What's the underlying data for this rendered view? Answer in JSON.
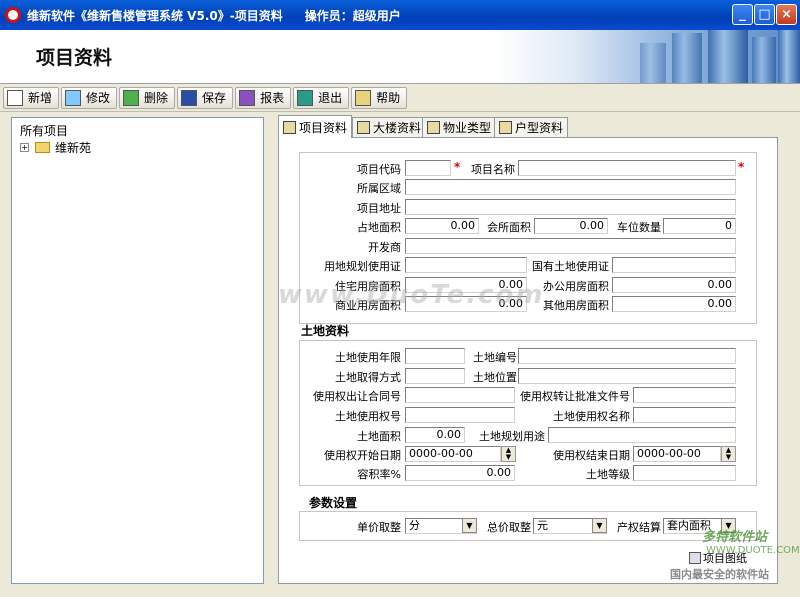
{
  "window": {
    "title": "维新软件《维新售楼管理系统 V5.0》-项目资料",
    "operator": "操作员：超级用户",
    "minimize": "_",
    "maximize": "□",
    "close": "×"
  },
  "banner": {
    "title": "项目资料"
  },
  "toolbar": [
    {
      "label": "新增",
      "icon": "new-icon",
      "color": "#ffffff"
    },
    {
      "label": "修改",
      "icon": "edit-icon",
      "color": "#7fc9ff"
    },
    {
      "label": "删除",
      "icon": "delete-icon",
      "color": "#4fb04f"
    },
    {
      "label": "保存",
      "icon": "save-icon",
      "color": "#2b4da8"
    },
    {
      "label": "报表",
      "icon": "report-icon",
      "color": "#8a50c0"
    },
    {
      "label": "退出",
      "icon": "exit-icon",
      "color": "#2a9a8a"
    },
    {
      "label": "帮助",
      "icon": "help-icon",
      "color": "#e9d27c"
    }
  ],
  "tree": {
    "root": "所有项目",
    "child": "维新苑",
    "expander": "+"
  },
  "tabs": [
    "项目资料",
    "大楼资料",
    "物业类型",
    "户型资料"
  ],
  "project": {
    "code_label": "项目代码",
    "code": "",
    "name_label": "项目名称",
    "name": "",
    "region_label": "所属区域",
    "region": "",
    "address_label": "项目地址",
    "address": "",
    "land_area_label": "占地面积",
    "land_area": "0.00",
    "club_area_label": "会所面积",
    "club_area": "0.00",
    "parking_label": "车位数量",
    "parking": "0",
    "developer_label": "开发商",
    "developer": "",
    "planning_cert_label": "用地规划使用证",
    "planning_cert": "",
    "state_land_cert_label": "国有土地使用证",
    "state_land_cert": "",
    "residential_area_label": "住宅用房面积",
    "residential_area": "0.00",
    "office_area_label": "办公用房面积",
    "office_area": "0.00",
    "commercial_area_label": "商业用房面积",
    "commercial_area": "0.00",
    "other_area_label": "其他用房面积",
    "other_area": "0.00",
    "required_mark": "*"
  },
  "land": {
    "section": "土地资料",
    "years_label": "土地使用年限",
    "years": "",
    "number_label": "土地编号",
    "number": "",
    "method_label": "土地取得方式",
    "method": "",
    "location_label": "土地位置",
    "location": "",
    "contract_label": "使用权出让合同号",
    "contract": "",
    "approval_label": "使用权转让批准文件号",
    "approval": "",
    "right_no_label": "土地使用权号",
    "right_no": "",
    "right_name_label": "土地使用权名称",
    "right_name": "",
    "area_label": "土地面积",
    "area": "0.00",
    "planning_use_label": "土地规划用途",
    "planning_use": "",
    "start_date_label": "使用权开始日期",
    "start_date": "0000-00-00",
    "end_date_label": "使用权结束日期",
    "end_date": "0000-00-00",
    "plot_ratio_label": "容积率%",
    "plot_ratio": "0.00",
    "grade_label": "土地等级",
    "grade": ""
  },
  "params": {
    "section": "参数设置",
    "unit_price_label": "单价取整",
    "unit_price": "分",
    "total_price_label": "总价取整",
    "total_price": "元",
    "settlement_label": "产权结算",
    "settlement": "套内面积"
  },
  "project_map_button": "项目图纸",
  "watermark": "www.DuoTe.com",
  "corner_logo": {
    "text": "多特软件站",
    "url": "WWW.DUOTE.COM",
    "slogan": "国内最安全的软件站"
  }
}
